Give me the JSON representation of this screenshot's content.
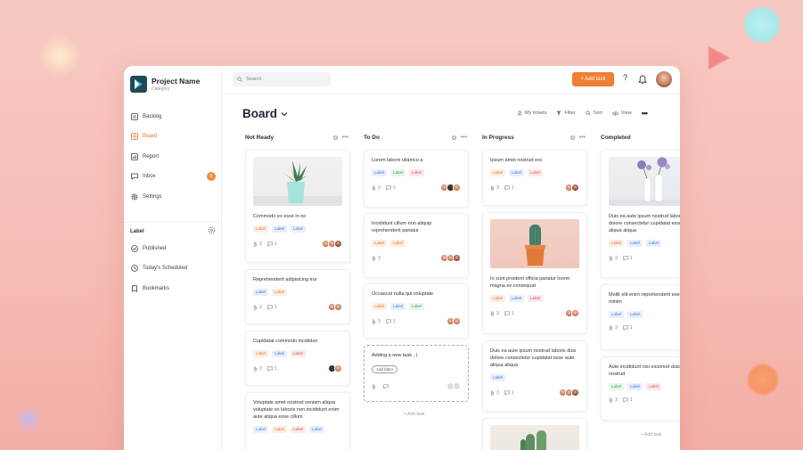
{
  "sidebar": {
    "project_name": "Project Name",
    "category": "Category",
    "nav": [
      {
        "label": "Backlog",
        "icon": "backlog-icon"
      },
      {
        "label": "Board",
        "icon": "board-icon",
        "active": true
      },
      {
        "label": "Report",
        "icon": "report-icon"
      },
      {
        "label": "Inbox",
        "icon": "inbox-icon",
        "badge": "6"
      },
      {
        "label": "Settings",
        "icon": "settings-icon"
      }
    ],
    "label_section": "Label",
    "label_items": [
      {
        "label": "Published",
        "icon": "check-circle-icon"
      },
      {
        "label": "Today's Scheduled",
        "icon": "clock-icon"
      },
      {
        "label": "Bookmarks",
        "icon": "bookmark-icon"
      }
    ]
  },
  "topbar": {
    "search_placeholder": "Search",
    "add_task": "+ Add task",
    "help": "?"
  },
  "board": {
    "title": "Board",
    "tools": [
      "My tickets",
      "Filter",
      "Sort",
      "View"
    ]
  },
  "columns": [
    {
      "title": "Not Ready",
      "cards": [
        {
          "title": "Commodo ex esse in no",
          "image": "succulent-pot",
          "tags": [
            "Label",
            "Label",
            "Label"
          ],
          "files": "3",
          "comments": "1"
        },
        {
          "title": "Reprehenderit adipisicing irur",
          "tags": [
            "Label",
            "Label"
          ],
          "files": "3",
          "comments": "1"
        },
        {
          "title": "Cupidatat commodo incididun",
          "tags": [
            "Label",
            "Label",
            "Label"
          ],
          "files": "3",
          "comments": "1"
        },
        {
          "title": "Voluptate amet nostrud veniam aliqua voluptate ex laboris non incididunt enim aute aliqua esse cillum",
          "tags": [
            "Label",
            "Label",
            "Label",
            "Label"
          ]
        }
      ]
    },
    {
      "title": "To Do",
      "cards": [
        {
          "title": "Lorem labore ullamco a",
          "tags": [
            "Label",
            "Label",
            "Label"
          ],
          "files": "3",
          "comments": "1"
        },
        {
          "title": "Incididunt cillum non aliquip reprehenderit pariatur",
          "tags": [
            "Label",
            "Label"
          ],
          "files": "3"
        },
        {
          "title": "Occaecat nulla qui voluptate",
          "tags": [
            "Label",
            "Label",
            "Label"
          ],
          "files": "3",
          "comments": "1"
        },
        {
          "title": "Adding a new task...|",
          "add_label": "Add label"
        }
      ],
      "add_task": "+ Add task"
    },
    {
      "title": "In Progress",
      "cards": [
        {
          "title": "Ipsum amet nostrud exc",
          "tags": [
            "Label",
            "Label",
            "Label"
          ],
          "files": "3",
          "comments": "1"
        },
        {
          "title": "In sunt proident officia pariatur lorem magna ex consequat",
          "image": "cactus-pot",
          "tags": [
            "Label",
            "Label",
            "Label"
          ],
          "files": "3",
          "comments": "1"
        },
        {
          "title": "Duis ea aute ipsum nostrud laboris duis dolore consectetur cupidatat esse aute aliqua aliqua",
          "tags": [
            "Label"
          ],
          "files": "3",
          "comments": "1"
        },
        {
          "title": "",
          "image": "cactus-pot-2"
        }
      ]
    },
    {
      "title": "Completed",
      "cards": [
        {
          "title": "Duis ea aute ipsum nostrud laboris duis dolore consectetur cupidatat esse aute aliqua aliqua",
          "image": "flowers-vases",
          "tags": [
            "Label",
            "Label",
            "Label"
          ],
          "files": "3",
          "comments": "1"
        },
        {
          "title": "Mollit elit enim reprehenderit exercitation minim",
          "tags": [
            "Label",
            "Label"
          ],
          "files": "3",
          "comments": "1"
        },
        {
          "title": "Aute incididunt nisi eiusmod duis officia nostrud",
          "tags": [
            "Label",
            "Label",
            "Label"
          ],
          "files": "3",
          "comments": "1"
        }
      ],
      "add_task": "+ Add task"
    }
  ],
  "colors": {
    "accent": "#f07e33",
    "background": "#f6bdb5"
  }
}
